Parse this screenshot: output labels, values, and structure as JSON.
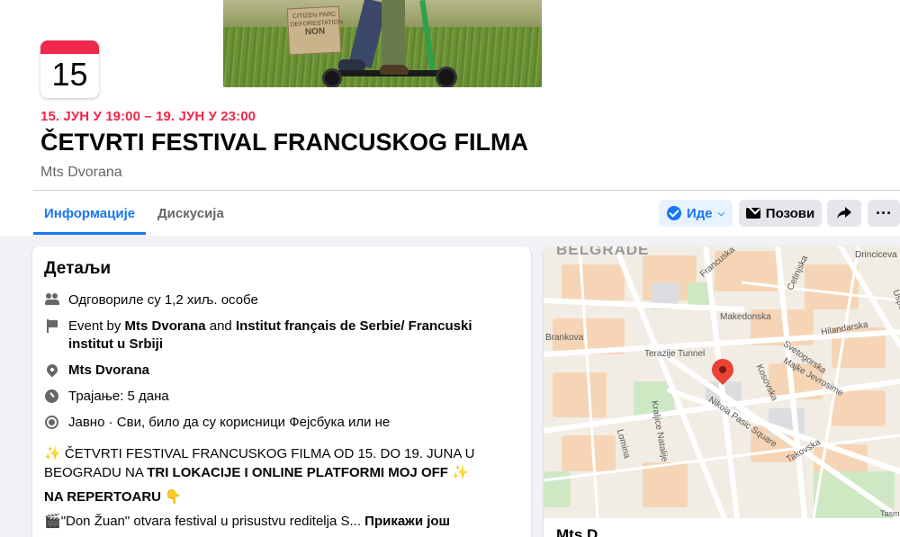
{
  "event": {
    "day": "15",
    "time": "15. ЈУН У 19:00 – 19. ЈУН У 23:00",
    "title": "ČETVRTI FESTIVAL FRANCUSKOG FILMA",
    "place": "Mts Dvorana",
    "cover_sign": {
      "line1": "CITIZEN PARC",
      "line2": "DEFORESTATION",
      "line3": "NON"
    }
  },
  "tabs": [
    {
      "label": "Информације",
      "active": true
    },
    {
      "label": "Дискусија",
      "active": false
    }
  ],
  "actions": {
    "going_label": "Иде",
    "invite_label": "Позови"
  },
  "details": {
    "title": "Детаљи",
    "responded": "Одговориле су 1,2 хиљ. особе",
    "event_by_prefix": "Event by ",
    "host1": "Mts Dvorana",
    "and": " and ",
    "host2": "Institut français de Serbie/ Francuski institut u Srbiji",
    "location": "Mts Dvorana",
    "duration": "Трајање: 5 дана",
    "privacy": "Јавно · Сви, било да су корисници Фејсбука или не",
    "desc_line1": "ČETVRTI FESTIVAL FRANCUSKOG FILMA OD 15. DO 19. JUNA U BEOGRADU",
    "desc_line2_prefix": "NA ",
    "desc_line2_bold": "TRI LOKACIJE I ONLINE PLATFORMI MOJ OFF",
    "repertoire": "NA REPERTOARU",
    "desc_line4": "\"Don Žuan\" otvara festival u prisustvu reditelja S...",
    "see_more": "Прикажи још"
  },
  "map": {
    "city": "BELGRADE",
    "labels": [
      "Francuska",
      "Cetinjska",
      "Drinciceva",
      "Makedonska",
      "Hilandarska",
      "Uspenska",
      "Brankova",
      "Terazije Tunnel",
      "Svetogorska",
      "Kosovska",
      "Majke Jevrosime",
      "Nikola Pasic Square",
      "Kraljice Natalije",
      "Lomina",
      "Takovska",
      "Tasm"
    ],
    "footer": "Mts D"
  },
  "colors": {
    "accent": "#1877f2",
    "date_red": "#f02849"
  }
}
